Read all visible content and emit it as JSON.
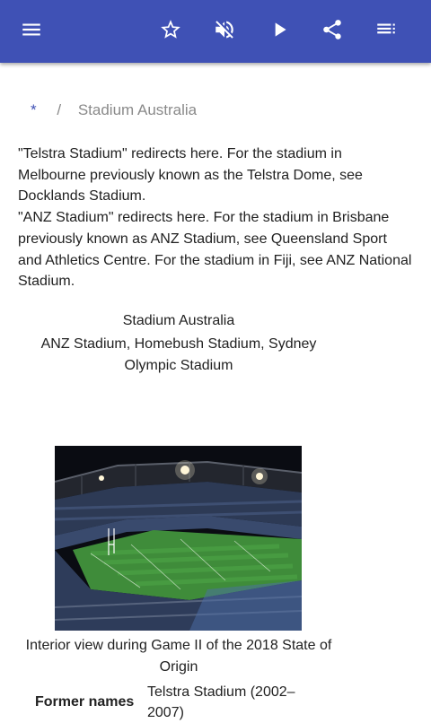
{
  "appbar": {
    "color": "#3f51b5",
    "icons": [
      "menu-icon",
      "star-icon",
      "volume-off-icon",
      "play-icon",
      "share-icon",
      "list-icon"
    ]
  },
  "breadcrumb": {
    "home": "*",
    "separator": "/",
    "current": "Stadium Australia"
  },
  "hatnotes": [
    {
      "prefix": "\"Telstra Stadium\" redirects here. For the stadium in Melbourne previously known as the Telstra Dome, see ",
      "link": "Docklands Stadium",
      "suffix": "."
    },
    {
      "prefix": "\"ANZ Stadium\" redirects here. For the stadium in Brisbane previously known as ANZ Stadium, see ",
      "link": "Queensland Sport and Athletics Centre",
      "middle": ". For the stadium in Fiji, see ",
      "link2": "ANZ National Stadium",
      "suffix": "."
    }
  ],
  "infobox": {
    "title": "Stadium Australia",
    "subtitle": "ANZ Stadium, Homebush Stadium, Sydney Olympic Stadium",
    "caption": "Interior view during Game II of the 2018 State of Origin",
    "rows": [
      {
        "label": "Former names",
        "value": "Telstra Stadium (2002–2007)"
      }
    ]
  }
}
